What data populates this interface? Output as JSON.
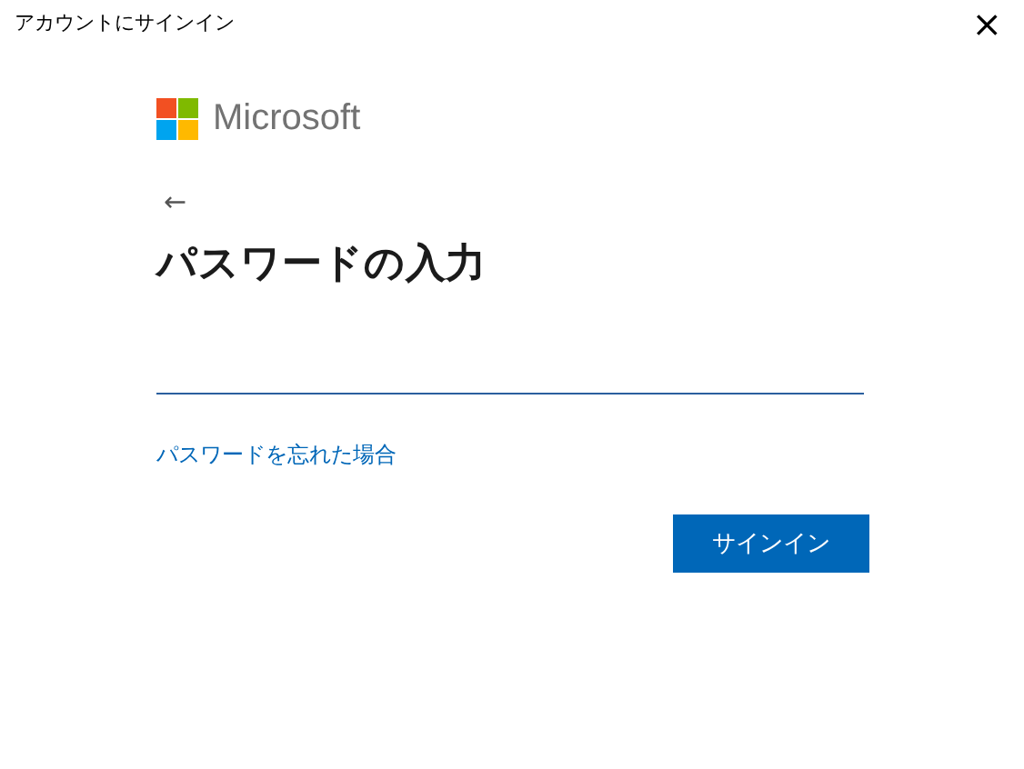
{
  "window": {
    "title": "アカウントにサインイン",
    "close": "×"
  },
  "brand": "Microsoft",
  "back": "←",
  "heading": "パスワードの入力",
  "password_field": {
    "focused": true
  },
  "forgot_link": "パスワードを忘れた場合",
  "buttons": [
    "サインイン"
  ]
}
